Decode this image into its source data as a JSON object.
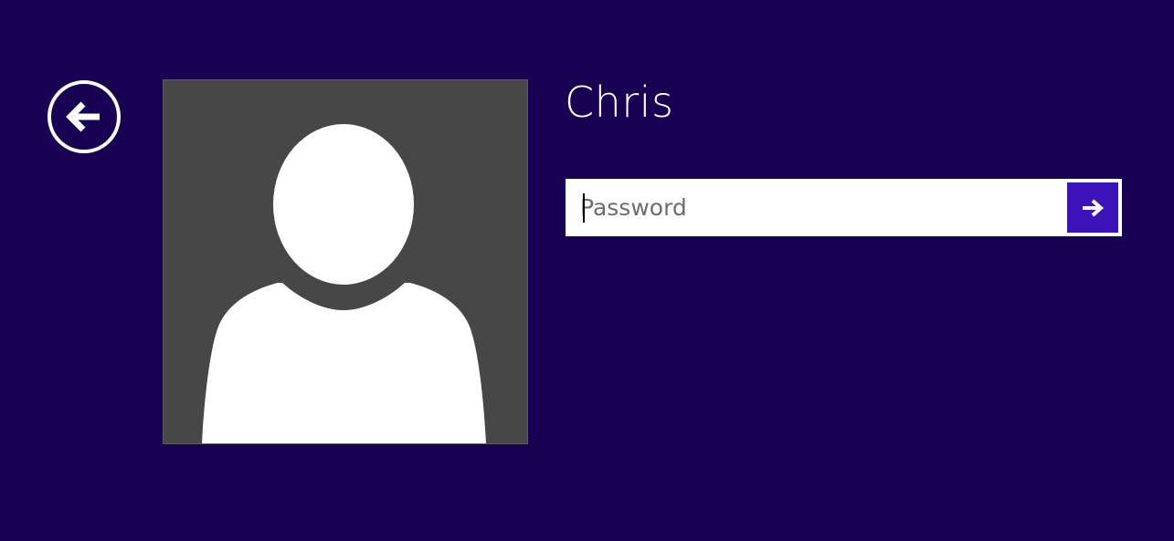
{
  "login": {
    "username": "Chris",
    "password_placeholder": "Password",
    "password_value": ""
  },
  "icons": {
    "back": "back-arrow-icon",
    "submit": "right-arrow-icon",
    "avatar": "default-user-avatar"
  },
  "colors": {
    "background": "#180052",
    "avatar_background": "#474747",
    "submit_button": "#3b13b8",
    "text": "#ffffff"
  }
}
